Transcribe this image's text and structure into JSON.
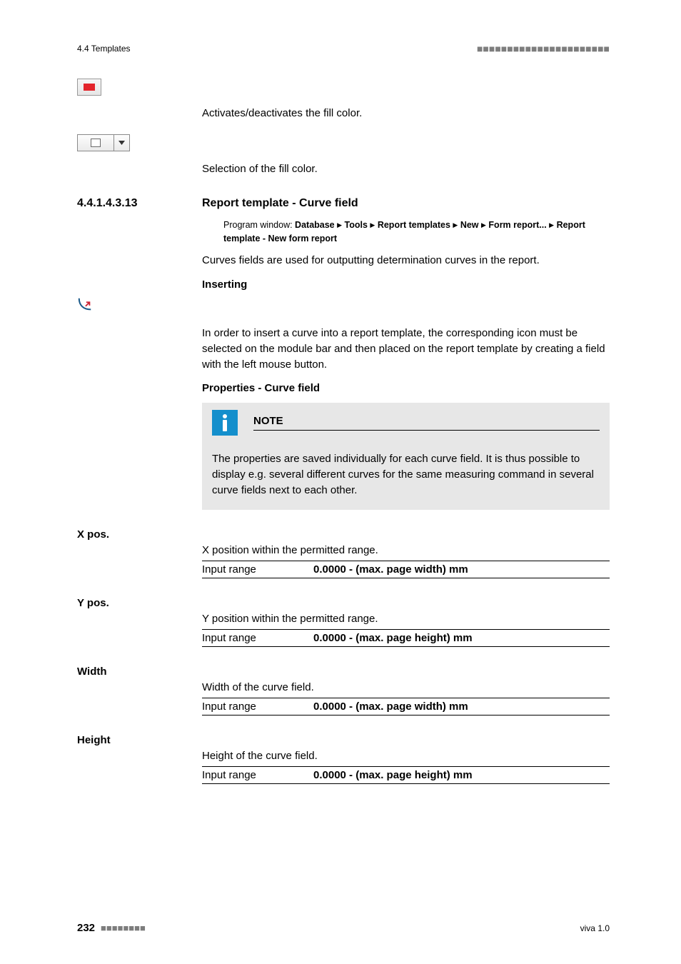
{
  "header": {
    "left": "4.4 Templates",
    "dashes": "■■■■■■■■■■■■■■■■■■■■■■"
  },
  "intro": {
    "fill_toggle_desc": "Activates/deactivates the fill color.",
    "fill_select_desc": "Selection of the fill color."
  },
  "section": {
    "number": "4.4.1.4.3.13",
    "title": "Report template - Curve field",
    "breadcrumb_prefix": "Program window: ",
    "breadcrumb": [
      "Database",
      "Tools",
      "Report templates",
      "New",
      "Form report...",
      "Report template - New form report"
    ],
    "intro_p": "Curves fields are used for outputting determination curves in the report.",
    "inserting_h": "Inserting",
    "inserting_p": "In order to insert a curve into a report template, the corresponding icon must be selected on the module bar and then placed on the report template by creating a field with the left mouse button.",
    "properties_h": "Properties - Curve field",
    "note_title": "NOTE",
    "note_body": "The properties are saved individually for each curve field. It is thus possible to display e.g. several different curves for the same measuring command in several curve fields next to each other."
  },
  "props": [
    {
      "label": "X pos.",
      "desc": "X position within the permitted range.",
      "range_label": "Input range",
      "range_value": "0.0000 - (max. page width) mm"
    },
    {
      "label": "Y pos.",
      "desc": "Y position within the permitted range.",
      "range_label": "Input range",
      "range_value": "0.0000 - (max. page height) mm"
    },
    {
      "label": "Width",
      "desc": "Width of the curve field.",
      "range_label": "Input range",
      "range_value": "0.0000 - (max. page width) mm"
    },
    {
      "label": "Height",
      "desc": "Height of the curve field.",
      "range_label": "Input range",
      "range_value": "0.0000 - (max. page height) mm"
    }
  ],
  "footer": {
    "page": "232",
    "dashes": "■■■■■■■■",
    "right": "viva 1.0"
  }
}
